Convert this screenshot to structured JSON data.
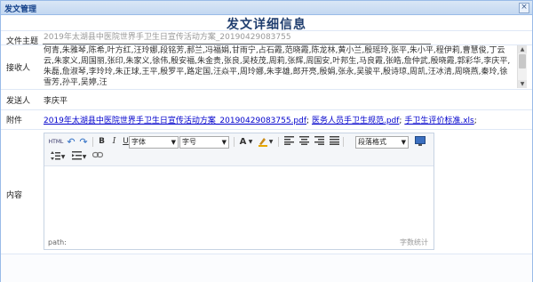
{
  "window": {
    "title": "发文管理",
    "close_glyph": "×"
  },
  "heading": "发文详细信息",
  "fields": {
    "subject_label": "文件主题",
    "subject_value": "2019年太湖县中医院世界手卫生日宣传活动方案_20190429083755",
    "recipients_label": "接收人",
    "recipients_value": "何青,朱雅琴,陈希,叶方红,汪玲娜,段铭芳,郝兰,冯福娟,甘雨宁,占石霞,范晓霞,陈龙林,黄小兰,殷瑶玲,张平,朱小平,程伊莉,曹慧俊,丁云云,朱家义,周国丽,张印,朱家义,徐伟,殷安福,朱金贵,张良,吴枝茂,周莉,张辉,周国安,叶邦生,马良霞,张皓,詹仲武,殷晓霞,郭彩华,李庆平,朱磊,詹淑琴,李玲玲,朱正球,王平,殷罗平,路定国,汪焱平,周玲娜,朱李雄,郎开亮,殷娟,张永,吴骏平,殷诗琼,周凯,汪冰清,周晓燕,秦玲,徐雪芳,孙平,吴婷,汪",
    "sender_label": "发送人",
    "sender_value": "李庆平",
    "attachment_label": "附件",
    "attachments": [
      "2019年太湖县中医院世界手卫生日宣传活动方案_20190429083755.pdf",
      "医务人员手卫生规范.pdf",
      "手卫生评价标准.xls"
    ],
    "attachment_sep": ";",
    "content_label": "内容"
  },
  "editor": {
    "html_label": "HTML",
    "undo_icon": "↶",
    "redo_icon": "↷",
    "bold_label": "B",
    "italic_label": "I",
    "underline_label": "U",
    "font_family_value": "字体",
    "font_size_value": "字号",
    "font_color_label": "A",
    "paragraph_format_value": "段落格式",
    "path_label": "path:",
    "word_count_label": "字数统计"
  }
}
